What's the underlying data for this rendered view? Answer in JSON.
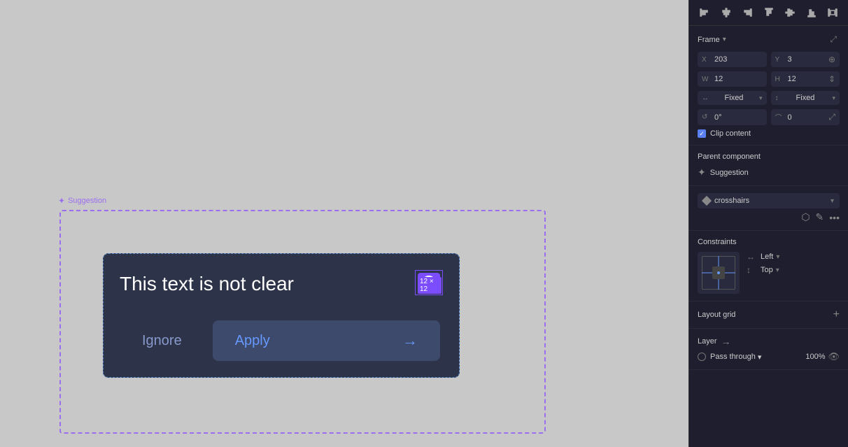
{
  "canvas": {
    "background": "#c8c8c8"
  },
  "suggestion": {
    "label": "Suggestion"
  },
  "card": {
    "title": "This text is not clear",
    "badge_size": "12 × 12",
    "btn_ignore": "Ignore",
    "btn_apply": "Apply"
  },
  "panel": {
    "align_icons": [
      "⊢",
      "⊥",
      "⊣",
      "⊤",
      "⊞",
      "⊟",
      "⊠"
    ],
    "frame_label": "Frame",
    "x_label": "X",
    "x_value": "203",
    "y_label": "Y",
    "y_value": "3",
    "w_label": "W",
    "w_value": "12",
    "h_label": "H",
    "h_value": "12",
    "fixed_w_label": "Fixed",
    "fixed_h_label": "Fixed",
    "rotation_label": "°",
    "rotation_value": "0°",
    "corner_value": "0",
    "clip_content_label": "Clip content",
    "parent_component_label": "Parent component",
    "parent_comp_name": "Suggestion",
    "variant_name": "crosshairs",
    "constraints_label": "Constraints",
    "left_label": "Left",
    "top_label": "Top",
    "layout_grid_label": "Layout grid",
    "layer_label": "Layer",
    "pass_through_label": "Pass through",
    "opacity_value": "100%"
  }
}
